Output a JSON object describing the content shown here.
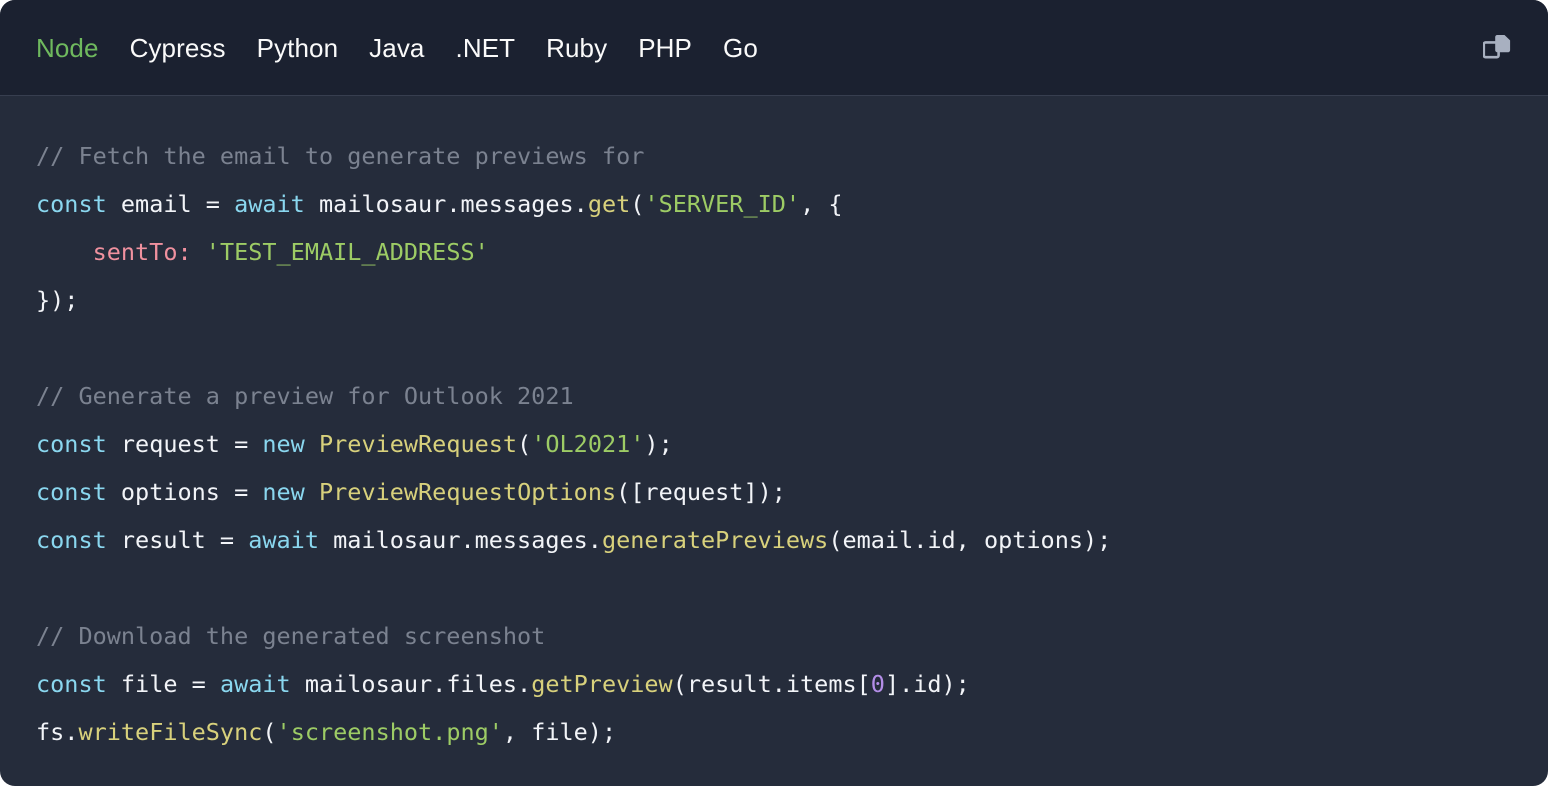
{
  "card": {
    "background": "#252c3b",
    "header_background": "#1b2130",
    "border_radius": "15px"
  },
  "header": {
    "tabs": [
      {
        "label": "Node",
        "active": true
      },
      {
        "label": "Cypress",
        "active": false
      },
      {
        "label": "Python",
        "active": false
      },
      {
        "label": "Java",
        "active": false
      },
      {
        "label": ".NET",
        "active": false
      },
      {
        "label": "Ruby",
        "active": false
      },
      {
        "label": "PHP",
        "active": false
      },
      {
        "label": "Go",
        "active": false
      }
    ],
    "active_tab": "Node",
    "active_tab_color": "#6fb95e",
    "inactive_tab_color": "#fafafa",
    "copy_button": {
      "icon": "copy-icon",
      "title": "Copy",
      "color": "#a8b0c0"
    }
  },
  "code": {
    "language": "javascript",
    "theme_colors": {
      "comment": "#7b8290",
      "keyword": "#8ad7ef",
      "function": "#d8d17c",
      "string": "#9dcc65",
      "property": "#f0919f",
      "number": "#b48ee8",
      "plain": "#f2f4f8"
    },
    "plain_text": "// Fetch the email to generate previews for\nconst email = await mailosaur.messages.get('SERVER_ID', {\n    sentTo: 'TEST_EMAIL_ADDRESS'\n});\n\n// Generate a preview for Outlook 2021\nconst request = new PreviewRequest('OL2021');\nconst options = new PreviewRequestOptions([request]);\nconst result = await mailosaur.messages.generatePreviews(email.id, options);\n\n// Download the generated screenshot\nconst file = await mailosaur.files.getPreview(result.items[0].id);\nfs.writeFileSync('screenshot.png', file);",
    "lines": [
      [
        {
          "t": "// Fetch the email to generate previews for",
          "c": "com"
        }
      ],
      [
        {
          "t": "const",
          "c": "kw"
        },
        {
          "t": " email = ",
          "c": "pl"
        },
        {
          "t": "await",
          "c": "kw"
        },
        {
          "t": " mailosaur.messages.",
          "c": "pl"
        },
        {
          "t": "get",
          "c": "fn"
        },
        {
          "t": "(",
          "c": "pl"
        },
        {
          "t": "'SERVER_ID'",
          "c": "str"
        },
        {
          "t": ", {",
          "c": "pl"
        }
      ],
      [
        {
          "t": "    ",
          "c": "pl"
        },
        {
          "t": "sentTo",
          "c": "prop"
        },
        {
          "t": ":",
          "c": "prop"
        },
        {
          "t": " ",
          "c": "pl"
        },
        {
          "t": "'TEST_EMAIL_ADDRESS'",
          "c": "str"
        }
      ],
      [
        {
          "t": "});",
          "c": "pl"
        }
      ],
      [
        {
          "t": "",
          "c": "pl"
        }
      ],
      [
        {
          "t": "// Generate a preview for Outlook 2021",
          "c": "com"
        }
      ],
      [
        {
          "t": "const",
          "c": "kw"
        },
        {
          "t": " request = ",
          "c": "pl"
        },
        {
          "t": "new",
          "c": "kw"
        },
        {
          "t": " ",
          "c": "pl"
        },
        {
          "t": "PreviewRequest",
          "c": "fn"
        },
        {
          "t": "(",
          "c": "pl"
        },
        {
          "t": "'OL2021'",
          "c": "str"
        },
        {
          "t": ");",
          "c": "pl"
        }
      ],
      [
        {
          "t": "const",
          "c": "kw"
        },
        {
          "t": " options = ",
          "c": "pl"
        },
        {
          "t": "new",
          "c": "kw"
        },
        {
          "t": " ",
          "c": "pl"
        },
        {
          "t": "PreviewRequestOptions",
          "c": "fn"
        },
        {
          "t": "([request]);",
          "c": "pl"
        }
      ],
      [
        {
          "t": "const",
          "c": "kw"
        },
        {
          "t": " result = ",
          "c": "pl"
        },
        {
          "t": "await",
          "c": "kw"
        },
        {
          "t": " mailosaur.messages.",
          "c": "pl"
        },
        {
          "t": "generatePreviews",
          "c": "fn"
        },
        {
          "t": "(email.id, options);",
          "c": "pl"
        }
      ],
      [
        {
          "t": "",
          "c": "pl"
        }
      ],
      [
        {
          "t": "// Download the generated screenshot",
          "c": "com"
        }
      ],
      [
        {
          "t": "const",
          "c": "kw"
        },
        {
          "t": " file = ",
          "c": "pl"
        },
        {
          "t": "await",
          "c": "kw"
        },
        {
          "t": " mailosaur.files.",
          "c": "pl"
        },
        {
          "t": "getPreview",
          "c": "fn"
        },
        {
          "t": "(result.items[",
          "c": "pl"
        },
        {
          "t": "0",
          "c": "num"
        },
        {
          "t": "].id);",
          "c": "pl"
        }
      ],
      [
        {
          "t": "fs.",
          "c": "pl"
        },
        {
          "t": "writeFileSync",
          "c": "fn"
        },
        {
          "t": "(",
          "c": "pl"
        },
        {
          "t": "'screenshot.png'",
          "c": "str"
        },
        {
          "t": ", file);",
          "c": "pl"
        }
      ]
    ]
  }
}
